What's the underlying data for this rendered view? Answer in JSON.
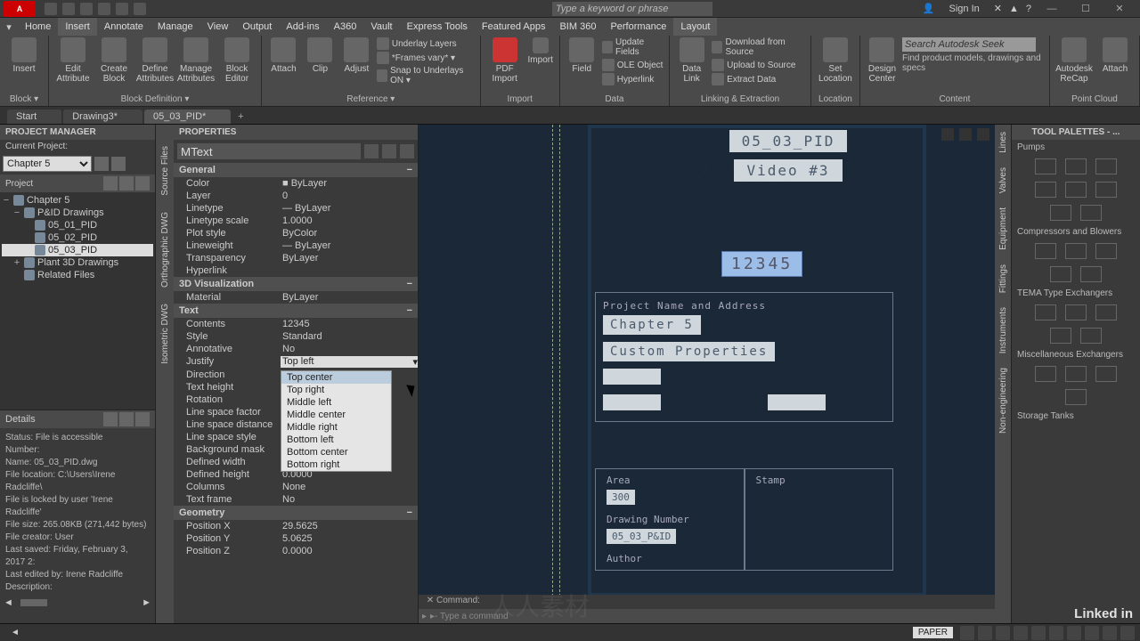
{
  "titlebar": {
    "search_placeholder": "Type a keyword or phrase",
    "signin": "Sign In"
  },
  "menu": {
    "items": [
      "Home",
      "Insert",
      "Annotate",
      "Manage",
      "View",
      "Output",
      "Add-ins",
      "A360",
      "Vault",
      "Express Tools",
      "Featured Apps",
      "BIM 360",
      "Performance",
      "Layout"
    ],
    "active": 1,
    "active2": 13
  },
  "ribbon": {
    "groups": [
      {
        "title": "Block ▾",
        "items": [
          {
            "lb": "Insert"
          }
        ],
        "sub": ""
      },
      {
        "title": "Block Definition ▾",
        "items": [
          {
            "lb": "Edit\nAttribute"
          },
          {
            "lb": "Create\nBlock"
          },
          {
            "lb": "Define\nAttributes"
          },
          {
            "lb": "Manage\nAttributes"
          },
          {
            "lb": "Block\nEditor"
          }
        ]
      },
      {
        "title": "Reference ▾",
        "items": [
          {
            "lb": "Attach"
          },
          {
            "lb": "Clip"
          },
          {
            "lb": "Adjust"
          }
        ],
        "lines": [
          "Underlay Layers",
          "*Frames vary* ▾",
          "Snap to Underlays ON ▾"
        ]
      },
      {
        "title": "Import",
        "items": [
          {
            "lb": "PDF\nImport"
          },
          {
            "lb": "Import"
          }
        ]
      },
      {
        "title": "Data",
        "items": [
          {
            "lb": "Field"
          }
        ],
        "lines": [
          "Update Fields",
          "OLE Object",
          "Hyperlink"
        ]
      },
      {
        "title": "Linking & Extraction",
        "items": [
          {
            "lb": "Data\nLink"
          }
        ],
        "lines": [
          "Download from Source",
          "Upload to Source",
          "Extract Data"
        ]
      },
      {
        "title": "Location",
        "items": [
          {
            "lb": "Set\nLocation"
          }
        ]
      },
      {
        "title": "Content",
        "items": [
          {
            "lb": "Design\nCenter"
          }
        ],
        "search": "Search Autodesk Seek",
        "text": "Find product models, drawings and specs"
      },
      {
        "title": "Point Cloud",
        "items": [
          {
            "lb": "Autodesk\nReCap"
          },
          {
            "lb": "Attach"
          }
        ]
      }
    ]
  },
  "filetabs": {
    "tabs": [
      "Start",
      "Drawing3*",
      "05_03_PID*"
    ],
    "active": 2
  },
  "pm": {
    "title": "PROJECT MANAGER",
    "sub": "Current Project:",
    "sel": "Chapter 5",
    "project": "Project",
    "tree": [
      {
        "t": "Chapter 5",
        "ind": 0,
        "exp": "−"
      },
      {
        "t": "P&ID Drawings",
        "ind": 1,
        "exp": "−"
      },
      {
        "t": "05_01_PID",
        "ind": 2
      },
      {
        "t": "05_02_PID",
        "ind": 2
      },
      {
        "t": "05_03_PID",
        "ind": 2,
        "sel": true
      },
      {
        "t": "Plant 3D Drawings",
        "ind": 1,
        "exp": "+"
      },
      {
        "t": "Related Files",
        "ind": 1
      }
    ],
    "details": {
      "title": "Details",
      "body": "Status: File is accessible\nNumber:\nName: 05_03_PID.dwg\nFile location: C:\\Users\\Irene Radcliffe\\\nFile is locked by user 'Irene Radcliffe'\nFile size: 265.08KB (271,442 bytes)\nFile creator: User\nLast saved: Friday, February 3, 2017 2:\nLast edited by: Irene Radcliffe\nDescription:"
    }
  },
  "sidetabs": [
    "Source Files",
    "Orthographic DWG",
    "Isometric DWG"
  ],
  "props": {
    "title": "PROPERTIES",
    "obj": "MText",
    "general": {
      "title": "General",
      "rows": [
        [
          "Color",
          "■ ByLayer"
        ],
        [
          "Layer",
          "0"
        ],
        [
          "Linetype",
          "— ByLayer"
        ],
        [
          "Linetype scale",
          "1.0000"
        ],
        [
          "Plot style",
          "ByColor"
        ],
        [
          "Lineweight",
          "— ByLayer"
        ],
        [
          "Transparency",
          "ByLayer"
        ],
        [
          "Hyperlink",
          ""
        ]
      ]
    },
    "viz": {
      "title": "3D Visualization",
      "rows": [
        [
          "Material",
          "ByLayer"
        ]
      ]
    },
    "text": {
      "title": "Text",
      "rows": [
        [
          "Contents",
          "12345"
        ],
        [
          "Style",
          "Standard"
        ],
        [
          "Annotative",
          "No"
        ],
        [
          "Justify",
          "Top left"
        ],
        [
          "Direction",
          ""
        ],
        [
          "Text height",
          ""
        ],
        [
          "Rotation",
          ""
        ],
        [
          "Line space factor",
          ""
        ],
        [
          "Line space distance",
          ""
        ],
        [
          "Line space style",
          ""
        ],
        [
          "Background mask",
          ""
        ],
        [
          "Defined width",
          "0.0000"
        ],
        [
          "Defined height",
          "0.0000"
        ],
        [
          "Columns",
          "None"
        ],
        [
          "Text frame",
          "No"
        ]
      ],
      "justify_opts": [
        "Top center",
        "Top right",
        "Middle left",
        "Middle center",
        "Middle right",
        "Bottom left",
        "Bottom center",
        "Bottom right"
      ]
    },
    "geom": {
      "title": "Geometry",
      "rows": [
        [
          "Position X",
          "29.5625"
        ],
        [
          "Position Y",
          "5.0625"
        ],
        [
          "Position Z",
          "0.0000"
        ]
      ]
    }
  },
  "drawing": {
    "title": "05_03_PID",
    "subtitle": "Video #3",
    "number": "12345",
    "proj_label": "Project Name and Address",
    "proj_name": "Chapter 5",
    "proj_props": "Custom Properties",
    "area_label": "Area",
    "area_val": "300",
    "stamp_label": "Stamp",
    "dwgnum_label": "Drawing Number",
    "dwgnum_val": "05_03_P&ID",
    "author_label": "Author"
  },
  "cmd": {
    "hist": "Command:",
    "prompt": "▸- Type a command"
  },
  "tp": {
    "title": "TOOL PALETTES - ...",
    "sects": [
      "Pumps",
      "Compressors and Blowers",
      "TEMA Type Exchangers",
      "Miscellaneous Exchangers",
      "Storage Tanks"
    ],
    "vtabs": [
      "Lines",
      "Valves",
      "Equipment",
      "Fittings",
      "Instruments",
      "Non-engineering"
    ]
  },
  "status": {
    "left": "◄",
    "paper": "PAPER",
    "linkedin": "Linked in"
  }
}
